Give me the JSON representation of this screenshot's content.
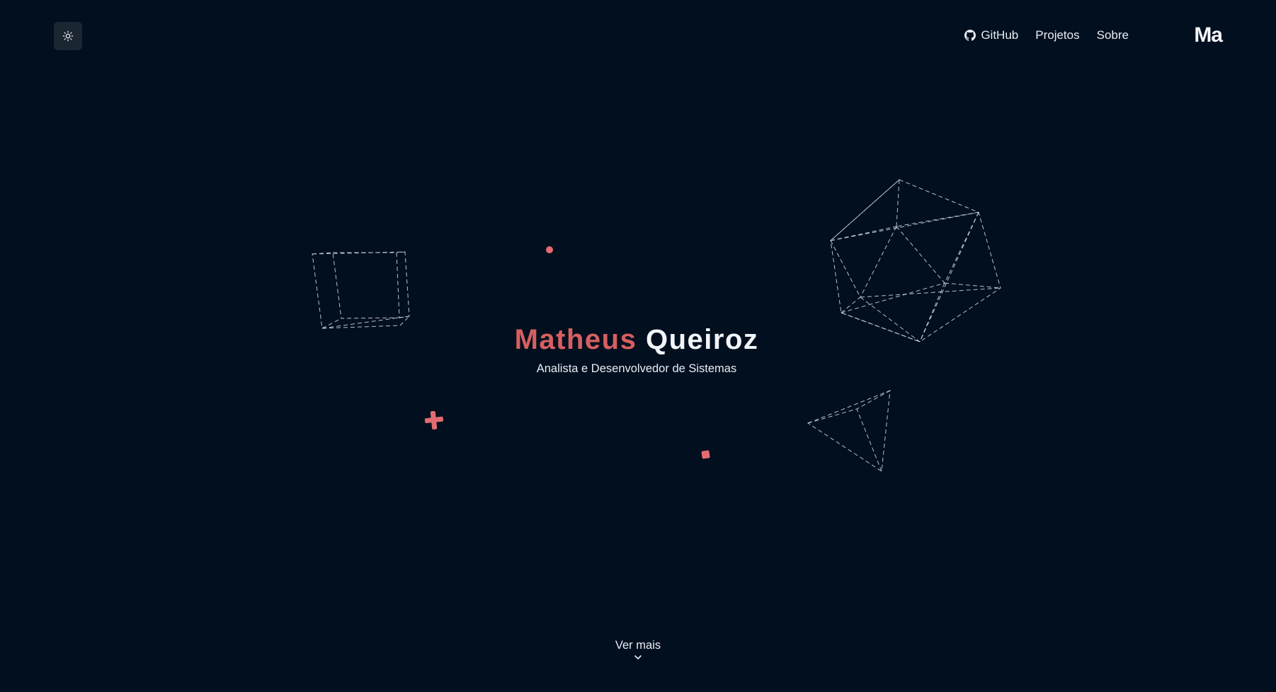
{
  "header": {
    "theme_toggle_icon": "sun-icon",
    "nav": [
      {
        "label": "GitHub",
        "icon": "github-icon"
      },
      {
        "label": "Projetos"
      },
      {
        "label": "Sobre"
      }
    ],
    "logo": "Ma"
  },
  "hero": {
    "first_name": "Matheus",
    "last_name": "Queiroz",
    "subtitle": "Analista e Desenvolvedor de Sistemas"
  },
  "footer": {
    "see_more_label": "Ver mais",
    "see_more_icon": "chevron-down-icon"
  },
  "colors": {
    "background": "#020f1f",
    "accent": "#d75f60",
    "text": "#e8edf3",
    "toggle_bg": "#1b2633"
  }
}
